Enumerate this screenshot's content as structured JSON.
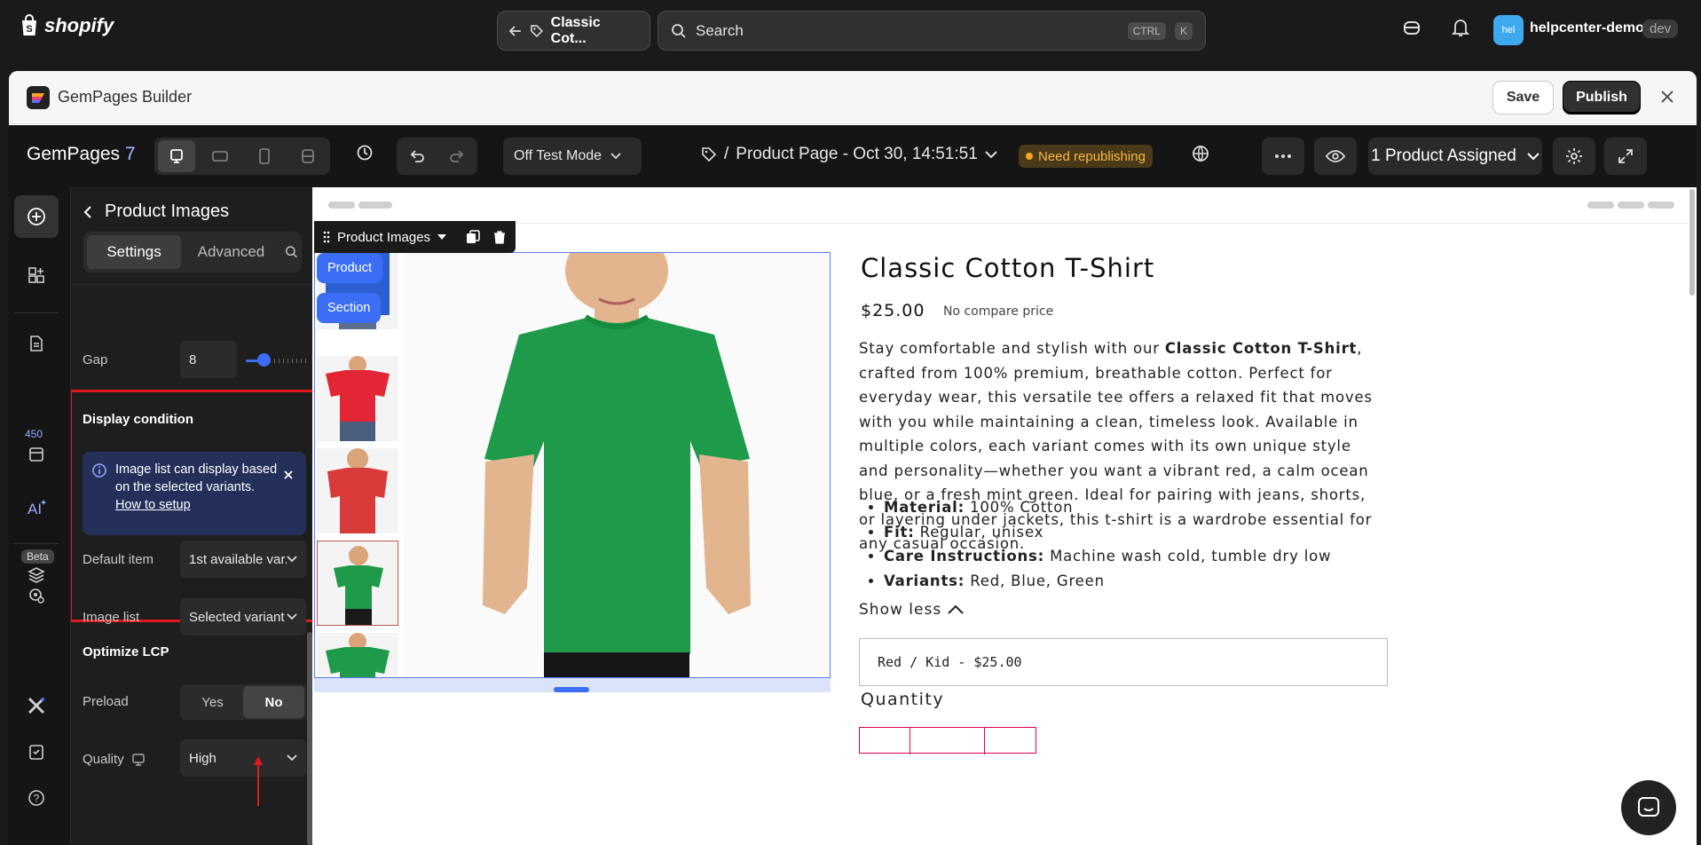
{
  "topbar": {
    "brand": "shopify",
    "breadcrumb": "Classic Cot...",
    "search_placeholder": "Search",
    "kbd_ctrl": "CTRL",
    "kbd_k": "K",
    "avatar_initials": "hel",
    "store_name": "helpcenter-demo",
    "env_badge": "dev"
  },
  "window": {
    "app_title": "GemPages Builder",
    "save_label": "Save",
    "publish_label": "Publish"
  },
  "toolbar": {
    "brand_name": "GemPages",
    "brand_version": "7",
    "test_mode": "Off Test Mode",
    "page_prefix": "/",
    "page_title": "Product Page - Oct 30, 14:51:51",
    "status_badge": "Need republishing",
    "assigned": "1 Product Assigned"
  },
  "sidebar": {
    "count": "450",
    "beta": "Beta",
    "ai_label": "AI"
  },
  "panel": {
    "title": "Product Images",
    "tabs": [
      "Settings",
      "Advanced"
    ],
    "gap_label": "Gap",
    "gap_value": "8",
    "gap_slider_fraction": 0.28,
    "display_condition_title": "Display condition",
    "info_text": "Image list can display based on the selected variants.",
    "info_link": "How to setup",
    "default_item_label": "Default item",
    "default_item_value": "1st available var...",
    "image_list_label": "Image list",
    "image_list_value": "Selected variant",
    "optimize_title": "Optimize LCP",
    "preload_label": "Preload",
    "preload_options": [
      "Yes",
      "No"
    ],
    "preload_selected": "No",
    "quality_label": "Quality",
    "quality_value": "High"
  },
  "canvas": {
    "layer_tag": "Product Images",
    "tag_product": "Product",
    "tag_section": "Section",
    "product": {
      "title": "Classic Cotton T-Shirt",
      "price": "$25.00",
      "compare": "No compare price",
      "desc_pre": "Stay comfortable and stylish with our ",
      "desc_bold": "Classic Cotton T-Shirt",
      "desc_post": ", crafted from 100% premium, breathable cotton. Perfect for everyday wear, this versatile tee offers a relaxed fit that moves with you while maintaining a clean, timeless look. Available in multiple colors, each variant comes with its own unique style and personality—whether you want a vibrant red, a calm ocean blue, or a fresh mint green. Ideal for pairing with jeans, shorts, or layering under jackets, this t-shirt is a wardrobe essential for any casual occasion.",
      "bullets": [
        {
          "k": "Material:",
          "v": " 100% Cotton"
        },
        {
          "k": "Fit:",
          "v": " Regular, unisex"
        },
        {
          "k": "Care Instructions:",
          "v": " Machine wash cold, tumble dry low"
        },
        {
          "k": "Variants:",
          "v": " Red, Blue, Green"
        }
      ],
      "show_less": "Show less",
      "variant": "Red / Kid - $25.00",
      "quantity_label": "Quantity"
    }
  },
  "colors": {
    "accent_blue": "#3b6ef5",
    "highlight_red": "#e0191f",
    "shirt_green": "#1e9a4a",
    "shirt_red": "#e32636",
    "shirt_blue": "#2d5fd0",
    "badge_orange": "#f5a623"
  }
}
